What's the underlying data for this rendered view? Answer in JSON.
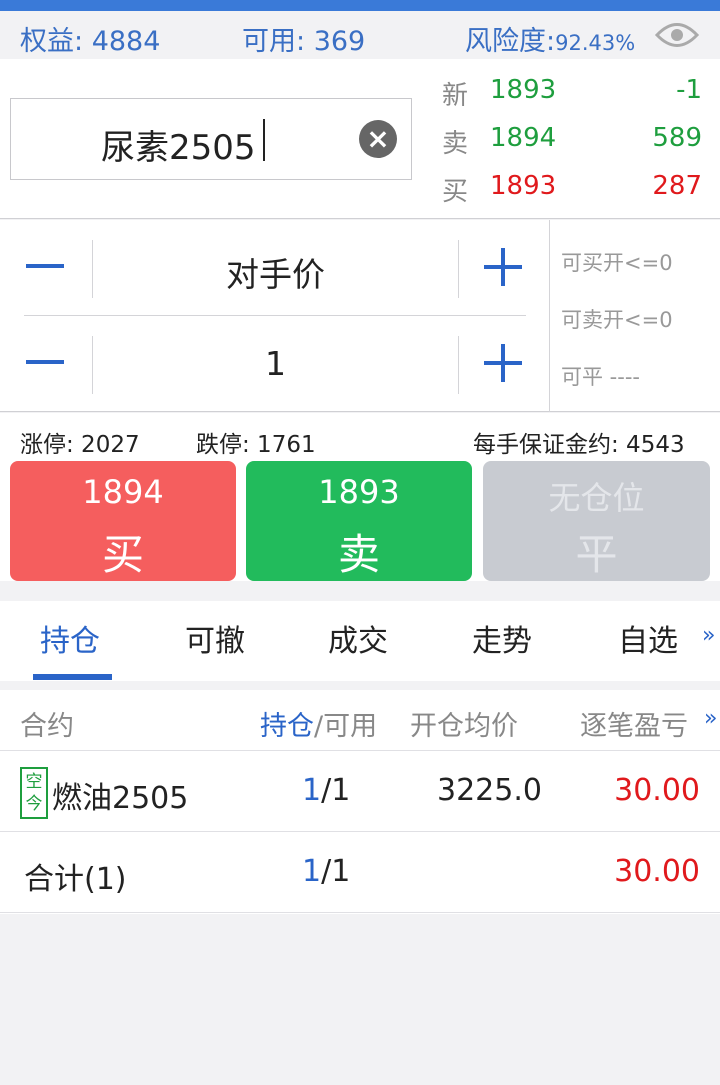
{
  "colors": {
    "accent": "#2a64c8",
    "buy": "#f55e5e",
    "sell": "#22bb5c",
    "disabled": "#c8cbd1",
    "up": "#e0191c",
    "down": "#1e9e3e"
  },
  "account": {
    "equity_label": "权益:",
    "equity_value": "4884",
    "available_label": "可用:",
    "available_value": "369",
    "risk_label": "风险度:",
    "risk_value": "92.43%",
    "eye_icon": "eye-icon"
  },
  "quote": {
    "symbol": "尿素2505",
    "clear_icon": "clear-icon",
    "rows": [
      {
        "label": "新",
        "price": "1893",
        "qty": "-1"
      },
      {
        "label": "卖",
        "price": "1894",
        "qty": "589"
      },
      {
        "label": "买",
        "price": "1893",
        "qty": "287"
      }
    ]
  },
  "order": {
    "price_type": "对手价",
    "quantity": "1",
    "can_buy_open": "可买开<=0",
    "can_sell_open": "可卖开<=0",
    "can_close": "可平 ----"
  },
  "limits": {
    "up_limit": "涨停: 2027",
    "down_limit": "跌停: 1761",
    "margin": "每手保证金约: 4543"
  },
  "buttons": {
    "buy_price": "1894",
    "buy_label": "买",
    "sell_price": "1893",
    "sell_label": "卖",
    "close_price": "无仓位",
    "close_label": "平"
  },
  "tabs": [
    "持仓",
    "可撤",
    "成交",
    "走势",
    "自选"
  ],
  "tabs_more": "»",
  "table": {
    "headers": {
      "contract": "合约",
      "position": "持仓",
      "slash_available": "/可用",
      "avg_price": "开仓均价",
      "pnl": "逐笔盈亏",
      "more": "»"
    },
    "rows": [
      {
        "tag_line1": "空",
        "tag_line2": "今",
        "contract": "燃油2505",
        "pos": "1",
        "avail": "/1",
        "avg": "3225.0",
        "pnl": "30.00"
      }
    ],
    "total": {
      "label": "合计(1)",
      "pos": "1",
      "avail": "/1",
      "pnl": "30.00"
    }
  }
}
